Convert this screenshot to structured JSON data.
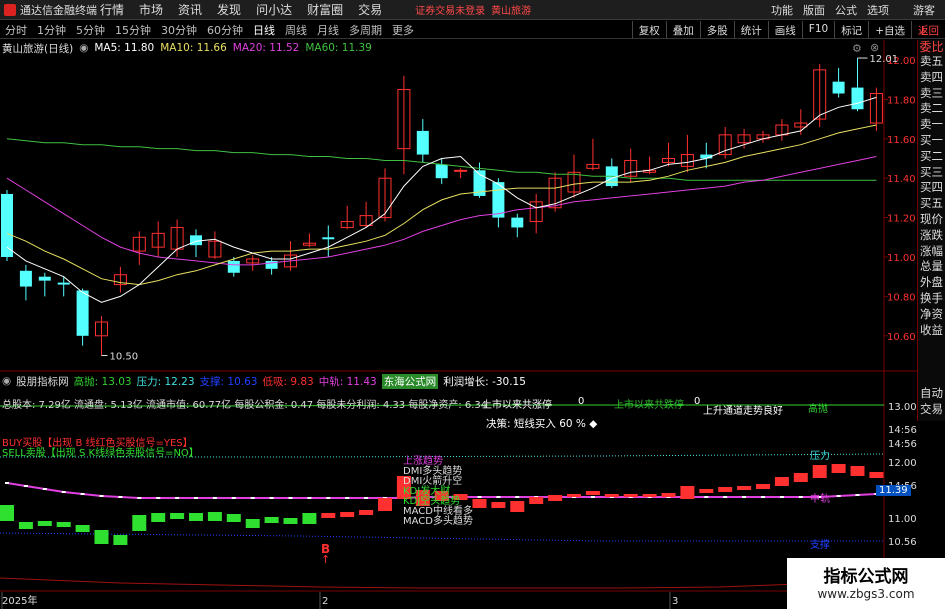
{
  "menubar": {
    "logo": "通达信金融终端",
    "items": [
      "行情",
      "市场",
      "资讯",
      "发现",
      "问小达",
      "财富圈",
      "交易"
    ],
    "warning": "证券交易未登录",
    "stock": "黄山旅游",
    "right": [
      "功能",
      "版面",
      "公式",
      "选项",
      "游客"
    ]
  },
  "periods": {
    "items": [
      "分时",
      "1分钟",
      "5分钟",
      "15分钟",
      "30分钟",
      "60分钟",
      "日线",
      "周线",
      "月线",
      "多周期",
      "更多"
    ],
    "active": "日线",
    "right": [
      "复权",
      "叠加",
      "多股",
      "统计",
      "画线",
      "F10",
      "标记",
      "+自选",
      "返回"
    ]
  },
  "info": {
    "name": "黄山旅游(日线)",
    "ma5": "MA5: 11.80",
    "ma10": "MA10: 11.66",
    "ma20": "MA20: 11.52",
    "ma60": "MA60: 11.39"
  },
  "right_panel": [
    "委比",
    "卖五",
    "卖四",
    "卖三",
    "卖二",
    "卖一",
    "买一",
    "买二",
    "买三",
    "买四",
    "买五",
    "现价",
    "涨跌",
    "涨幅",
    "总量",
    "外盘",
    "换手",
    "净资",
    "收益"
  ],
  "right_panel2": [
    "自动",
    "交易"
  ],
  "price_axis": [
    "12.00",
    "11.80",
    "11.60",
    "11.40",
    "11.20",
    "11.00",
    "10.80",
    "10.60"
  ],
  "price_labels": {
    "high": "12.01",
    "low": "10.50"
  },
  "indicator": {
    "name": "股朋指标网",
    "gaopao": "高抛: 13.03",
    "yali": "压力: 12.23",
    "zhicheng": "支撑: 10.63",
    "dixi": "低吸: 9.83",
    "zhongui": "中轨: 11.43",
    "legend": "东海公式网",
    "lirun": "利润增长: -30.15"
  },
  "stats": "总股本: 7.29亿 流通盘: 5.13亿 流通市值: 60.77亿 每股公积金: 0.47 每股未分利润: 4.33 每股净资产: 6.34",
  "notes": {
    "up": "上市以来共涨停",
    "up_n": "0",
    "down": "上市以来共跌停",
    "down_n": "0",
    "channel": "上升通道走势良好",
    "decision": "决策: 短线买入 60 % ◆",
    "buy": "BUY买股【出现 B 线红色买股信号=YES】",
    "sell": "SELL卖股【出现 S K线绿色卖股信号=NO】",
    "trend": "上涨趋势",
    "dmi1": "DMI多头趋势",
    "dmi2": "DMI火箭升空",
    "kdj1": "KDJ发大财",
    "kdj2": "KDJ空头趋势",
    "macd1": "MACD中线看多",
    "macd2": "MACD多头趋势",
    "b": "B",
    "gaopao": "高抛",
    "yali": "压力",
    "zhonggui": "中轨",
    "zhicheng": "支撑"
  },
  "ind_axis": [
    "13.00",
    "14:56",
    "14:56",
    "12.00",
    "14:56",
    "11.00",
    "10.56"
  ],
  "ind_value": "11.39",
  "dates": [
    "2025年",
    "2",
    "3"
  ],
  "watermark": {
    "w1": "指标公式网",
    "w2": "www.zbgs3.com"
  },
  "colors": {
    "up": "#ff3030",
    "down": "#54ffff",
    "ma5": "#ffffff",
    "ma10": "#e8e060",
    "ma20": "#e040e0",
    "ma60": "#40c040"
  }
}
